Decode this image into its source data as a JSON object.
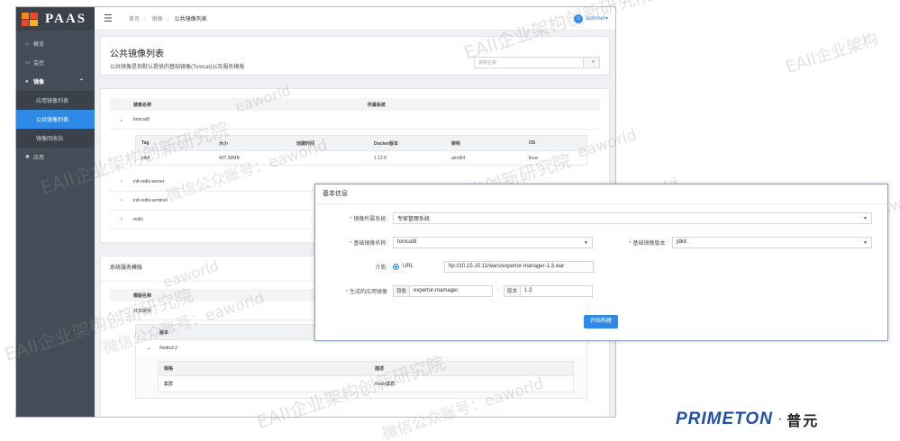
{
  "app": {
    "logo_text": "PAAS",
    "sidebar": {
      "items": [
        {
          "label": "概览",
          "icon": "home-icon"
        },
        {
          "label": "监控",
          "icon": "monitor-icon"
        },
        {
          "label": "镜像",
          "icon": "image-icon",
          "open": true
        },
        {
          "label": "应用",
          "icon": "app-icon"
        }
      ],
      "sub_items": [
        {
          "label": "应用镜像列表"
        },
        {
          "label": "公共镜像列表",
          "active": true
        },
        {
          "label": "镜像回收站"
        }
      ]
    },
    "topbar": {
      "crumbs": [
        "首页",
        "镜像",
        "公共镜像列表"
      ],
      "user": "summer"
    },
    "header": {
      "title": "公共镜像列表",
      "desc": "公共镜像是指默认提供的基础镜像(Tomcat)以及服务模版",
      "search_placeholder": "镜像名称"
    },
    "image_table": {
      "columns": [
        "镜像名称",
        "所属系统"
      ],
      "rows": [
        "tomcat9",
        "init-redis-server",
        "init-redis-sentinel",
        "redis"
      ],
      "detail": {
        "columns": [
          "Tag",
          "大小",
          "创建时间",
          "Docker版本",
          "架构",
          "OS"
        ],
        "row": [
          "jdk8",
          "407.90MB",
          "",
          "1.12.6",
          "amd64",
          "linux"
        ]
      }
    },
    "templates": {
      "title": "系统服务模版",
      "columns": [
        "模版名称"
      ],
      "rows": [
        "共享缓存"
      ],
      "version_header": "版本",
      "version": "Redis3.2",
      "spec_columns": [
        "规格",
        "描述"
      ],
      "spec_row": [
        "集群",
        "Redis集群"
      ]
    }
  },
  "dialog": {
    "title": "基本信息",
    "system_label": "镜像所属系统:",
    "system_value": "专家管理系统",
    "base_name_label": "基础镜像名称:",
    "base_name_value": "tomcat9",
    "base_version_label": "基础镜像版本:",
    "base_version_value": "jdk8",
    "media_label": "介质:",
    "media_option": "URL",
    "media_url": "ftp://10.15.15.11/wars/expertor-manager-1.3.war",
    "generated_label": "生成的应用镜像",
    "image_addon": "镜像",
    "image_value": "expertor-mamager",
    "colon": ":",
    "version_addon": "版本",
    "version_value": "1.3",
    "build_label": "开始构建"
  },
  "watermarks": [
    "EAII企业架构创新研究院",
    "微信公众账号：eaworld",
    "EAII企业架构创新研究院",
    "微信公众账号：eaworld",
    "EAII企业架构创新研究院",
    "微信公众账号：eaworld",
    "EAII企业架构创新研究院",
    "微信公众账号：eaworld",
    "EAII企业架构创新研究院",
    "eaworld",
    "eaworld",
    "eaworld",
    "EAII企业架构",
    "EAII企业架构创新研究院",
    "微信公众账号：eaworld"
  ],
  "brand": {
    "en": "PRIMETON",
    "dot": "·",
    "cn": "普元"
  }
}
